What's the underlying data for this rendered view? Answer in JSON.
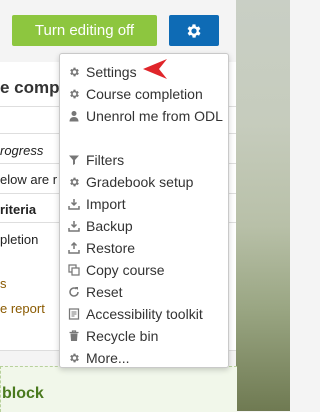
{
  "header": {
    "editing_button": "Turn editing off",
    "gear_button_icon": "gear-icon"
  },
  "course": {
    "heading": "e comp",
    "progress_label": "rogress",
    "below_text": "elow are r",
    "criteria_label": "riteria",
    "completion_text": "pletion",
    "link_s": "s",
    "link_report": "e report",
    "block_title": "block"
  },
  "menu": {
    "items": [
      {
        "label": "Settings",
        "icon": "gear-icon"
      },
      {
        "label": "Course completion",
        "icon": "gear-icon"
      },
      {
        "label": "Unenrol me from ODL",
        "icon": "user-icon"
      },
      {
        "label": "Filters",
        "icon": "filter-icon"
      },
      {
        "label": "Gradebook setup",
        "icon": "gear-icon"
      },
      {
        "label": "Import",
        "icon": "import-icon"
      },
      {
        "label": "Backup",
        "icon": "backup-icon"
      },
      {
        "label": "Restore",
        "icon": "restore-icon"
      },
      {
        "label": "Copy course",
        "icon": "copy-icon"
      },
      {
        "label": "Reset",
        "icon": "reset-icon"
      },
      {
        "label": "Accessibility toolkit",
        "icon": "accessibility-icon"
      },
      {
        "label": "Recycle bin",
        "icon": "trash-icon"
      },
      {
        "label": "More...",
        "icon": "gear-icon"
      }
    ]
  },
  "colors": {
    "editing_button": "#8dc63f",
    "gear_button": "#0e6bb5",
    "pointer_arrow": "#e0252a",
    "link": "#8a5a00",
    "block_title": "#4a7a1e"
  }
}
